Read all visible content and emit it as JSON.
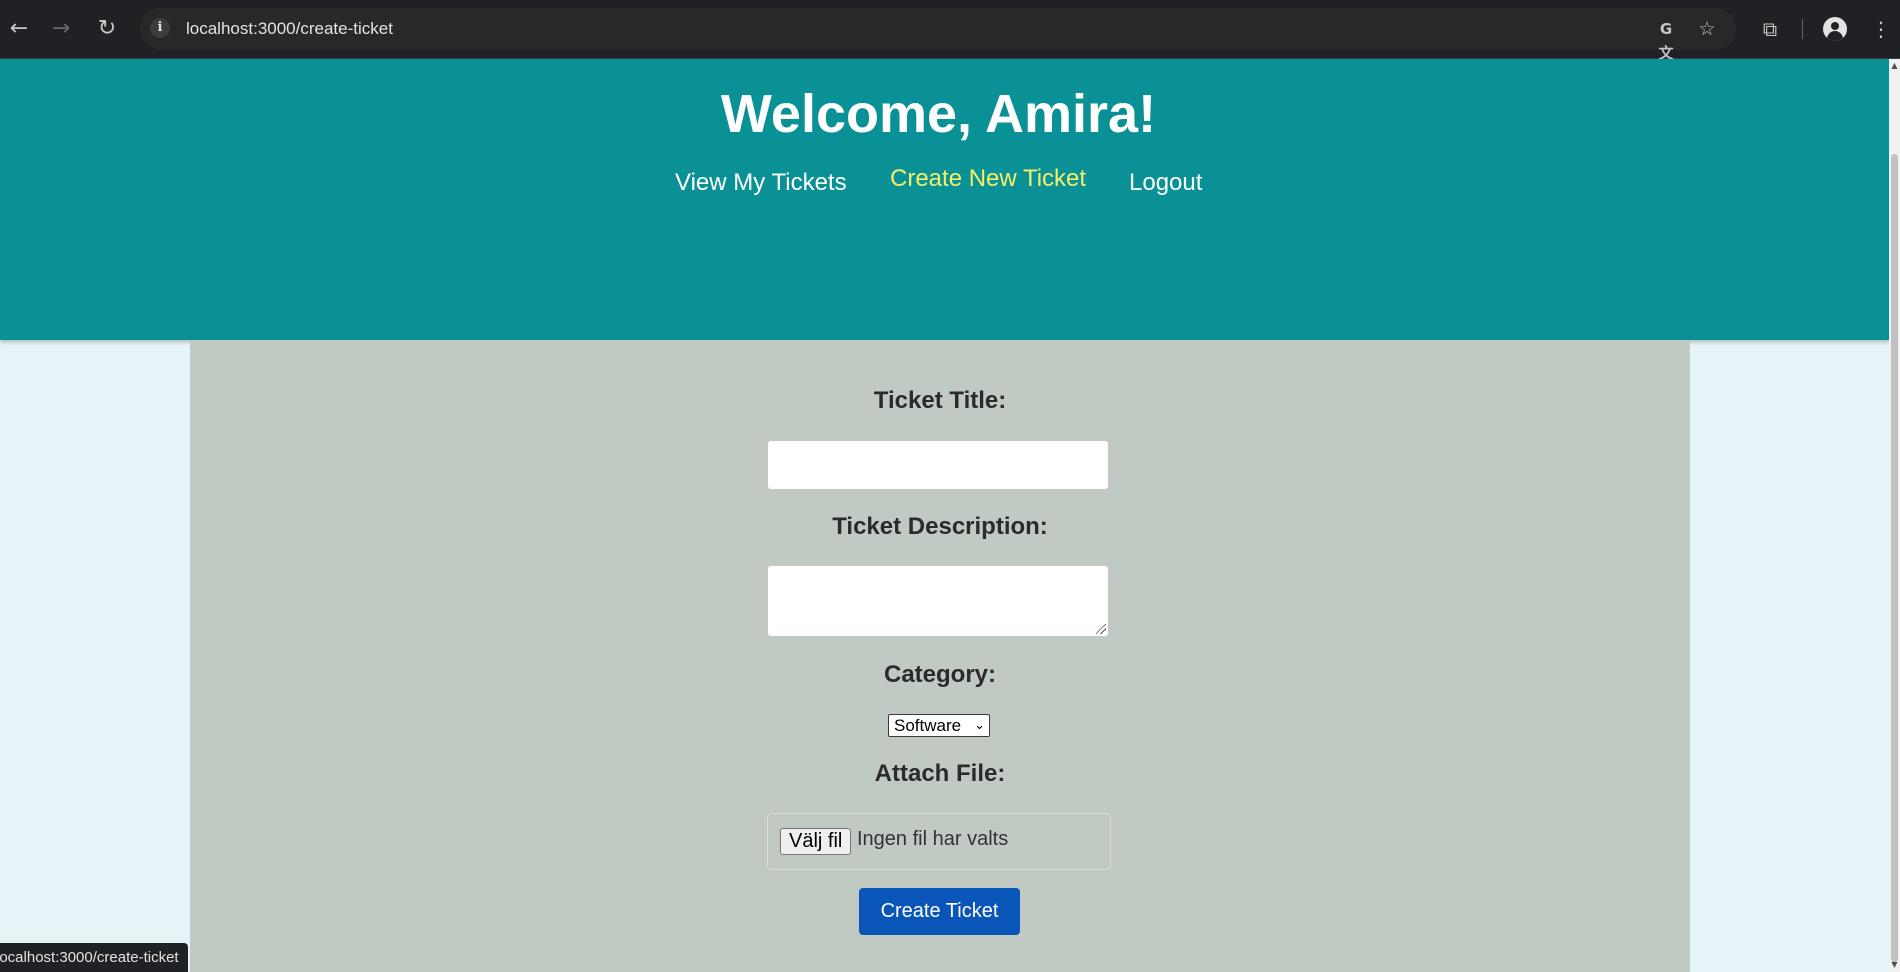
{
  "browser": {
    "url": "localhost:3000/create-ticket",
    "status_url": "localhost:3000/create-ticket",
    "icons": {
      "back": "arrow-left-icon",
      "forward": "arrow-right-icon",
      "reload": "reload-icon",
      "site_info": "info-icon",
      "translate": "translate-icon",
      "bookmark": "star-icon",
      "extensions": "puzzle-icon",
      "profile": "profile-icon",
      "menu": "kebab-menu-icon"
    }
  },
  "header": {
    "welcome": "Welcome, Amira!",
    "nav": [
      {
        "label": "View My Tickets",
        "active": false
      },
      {
        "label": "Create New Ticket",
        "active": true
      },
      {
        "label": "Logout",
        "active": false
      }
    ]
  },
  "form": {
    "title_label": "Ticket Title:",
    "title_value": "",
    "description_label": "Ticket Description:",
    "description_value": "",
    "category_label": "Category:",
    "category_selected": "Software",
    "attach_label": "Attach File:",
    "file_button": "Välj fil",
    "file_status": "Ingen fil har valts",
    "submit": "Create Ticket"
  },
  "colors": {
    "header_bg": "#0a9196",
    "active_link": "#f4ef6a",
    "form_bg": "#c1c9c3",
    "page_bg": "#e6f4f8",
    "button_bg": "#0a55b8"
  }
}
